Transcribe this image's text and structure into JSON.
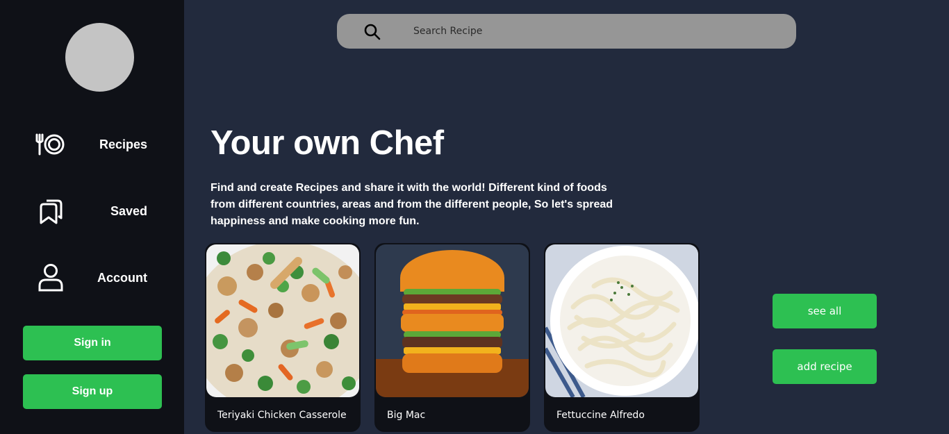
{
  "sidebar": {
    "items": [
      {
        "label": "Recipes",
        "icon": "fork-plate-icon"
      },
      {
        "label": "Saved",
        "icon": "bookmarks-icon"
      },
      {
        "label": "Account",
        "icon": "user-icon"
      }
    ],
    "signin_label": "Sign in",
    "signup_label": "Sign up"
  },
  "search": {
    "placeholder": "Search Recipe",
    "icon": "search-icon"
  },
  "hero": {
    "title": "Your own Chef",
    "description": "Find and create Recipes and share it with the world! Different kind of foods from different countries, areas and from the different people, So let's spread happiness and make cooking more fun."
  },
  "cards": [
    {
      "title": "Teriyaki Chicken Casserole"
    },
    {
      "title": "Big Mac"
    },
    {
      "title": "Fettuccine Alfredo"
    }
  ],
  "actions": {
    "see_all_label": "see all",
    "add_recipe_label": "add recipe"
  },
  "colors": {
    "accent": "#2dc052",
    "sidebar_bg": "#0f1117",
    "main_bg": "#222a3d",
    "search_bg": "#969696"
  }
}
